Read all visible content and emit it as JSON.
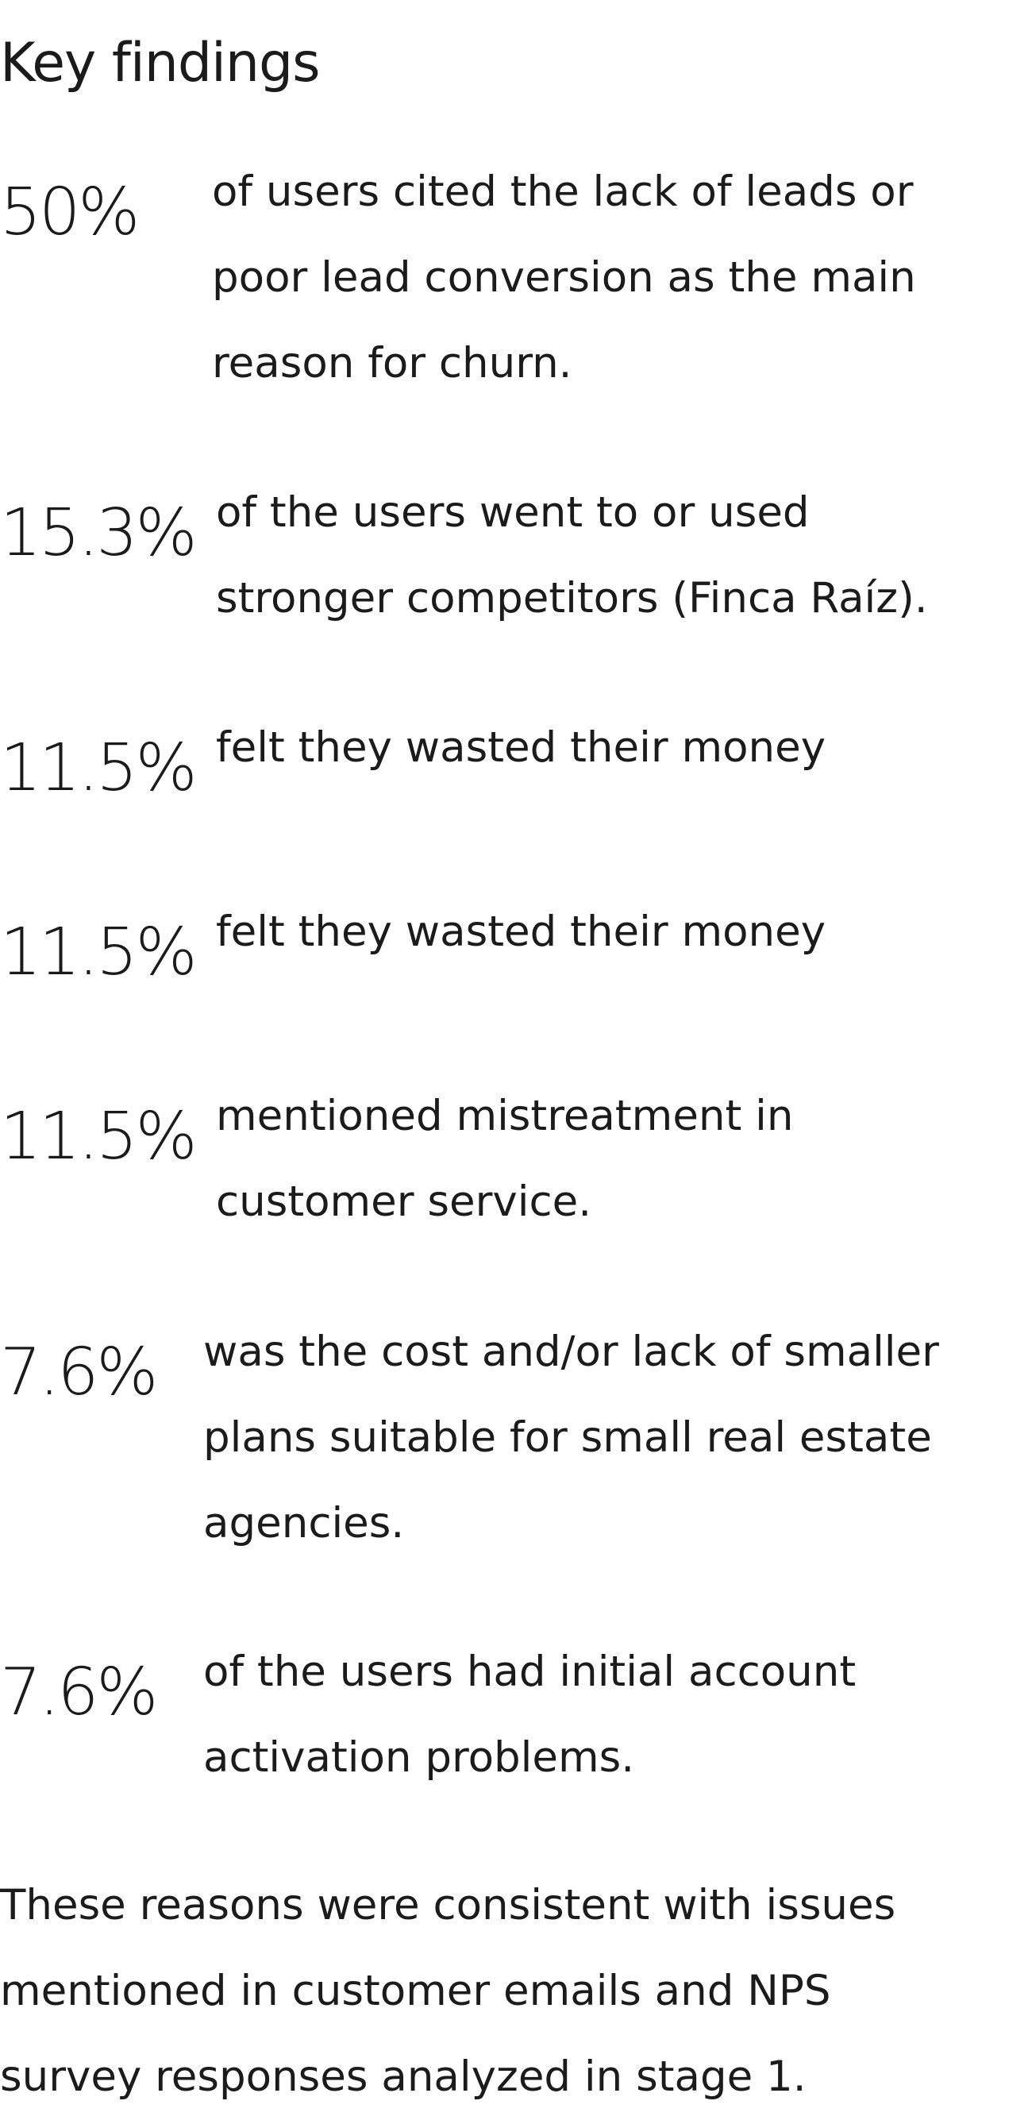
{
  "heading": "Key findings",
  "findings": [
    {
      "stat": "50%",
      "lines": [
        "of users cited the lack of leads or",
        "poor lead conversion as the main",
        "reason for churn."
      ]
    },
    {
      "stat": "15.3%",
      "lines": [
        "of the users went to or used",
        "stronger competitors (Finca Raíz)."
      ]
    },
    {
      "stat": "11.5%",
      "lines": [
        "felt they wasted their money"
      ]
    },
    {
      "stat": "11.5%",
      "lines": [
        "felt they wasted their money"
      ]
    },
    {
      "stat": "11.5%",
      "lines": [
        "mentioned mistreatment in",
        "customer service."
      ]
    },
    {
      "stat": "7.6%",
      "lines": [
        "was the cost and/or lack of smaller",
        "plans suitable for small real estate",
        "agencies."
      ]
    },
    {
      "stat": "7.6%",
      "lines": [
        "of the users had initial account",
        "activation problems."
      ]
    }
  ],
  "summary": [
    "These reasons were consistent with issues",
    "mentioned in customer emails and NPS",
    "survey responses analyzed in stage 1."
  ]
}
